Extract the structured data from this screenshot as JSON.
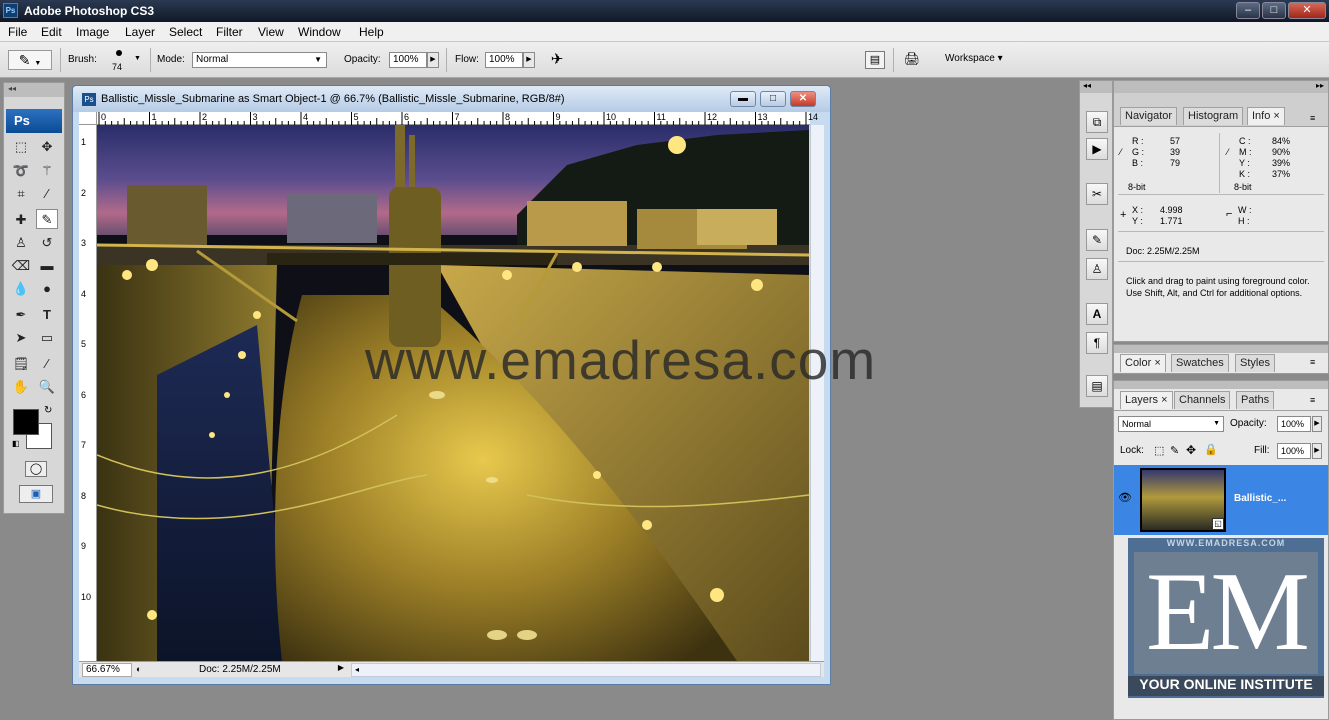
{
  "app": {
    "title": "Adobe Photoshop CS3",
    "icon": "Ps"
  },
  "window_controls": {
    "min": "–",
    "max": "□",
    "close": "✕"
  },
  "menu": [
    "File",
    "Edit",
    "Image",
    "Layer",
    "Select",
    "Filter",
    "View",
    "Window",
    "Help"
  ],
  "options_bar": {
    "brush_label": "Brush:",
    "brush_size": "74",
    "mode_label": "Mode:",
    "mode_value": "Normal",
    "opacity_label": "Opacity:",
    "opacity_value": "100%",
    "flow_label": "Flow:",
    "flow_value": "100%",
    "workspace_label": "Workspace ▾"
  },
  "tools_panel": {
    "logo": "Ps"
  },
  "document": {
    "title": "Ballistic_Missle_Submarine as Smart Object-1 @ 66.7% (Ballistic_Missle_Submarine, RGB/8#)",
    "ruler_top": [
      "0",
      "1",
      "2",
      "3",
      "4",
      "5",
      "6",
      "7",
      "8",
      "9",
      "10",
      "11",
      "12",
      "13",
      "14"
    ],
    "ruler_left": [
      "1",
      "2",
      "3",
      "4",
      "5",
      "6",
      "7",
      "8",
      "9",
      "10"
    ],
    "zoom": "66.67%",
    "doc_size": "Doc: 2.25M/2.25M",
    "watermark": "www.emadresa.com"
  },
  "info_panel": {
    "tabs": [
      "Navigator",
      "Histogram",
      "Info ×"
    ],
    "rgb": {
      "R": "57",
      "G": "39",
      "B": "79"
    },
    "cmyk": {
      "C": "84%",
      "M": "90%",
      "Y": "39%",
      "K": "37%"
    },
    "bit_left": "8-bit",
    "bit_right": "8-bit",
    "x": "4.998",
    "y": "1.771",
    "doc": "Doc: 2.25M/2.25M",
    "hint": "Click and drag to paint using foreground color.  Use Shift, Alt, and Ctrl for additional options."
  },
  "color_panel": {
    "tabs": [
      "Color ×",
      "Swatches",
      "Styles"
    ]
  },
  "layers_panel": {
    "tabs": [
      "Layers ×",
      "Channels",
      "Paths"
    ],
    "blend_mode": "Normal",
    "opacity_label": "Opacity:",
    "opacity": "100%",
    "lock_label": "Lock:",
    "fill_label": "Fill:",
    "fill": "100%",
    "layer_name": "Ballistic_..."
  },
  "logo": {
    "letters": "EM",
    "tagline": "YOUR ONLINE INSTITUTE",
    "url": "WWW.EMADRESA.COM"
  },
  "colors": {
    "accent": "#3b7fd9",
    "selected_layer": "#3b86e4"
  }
}
